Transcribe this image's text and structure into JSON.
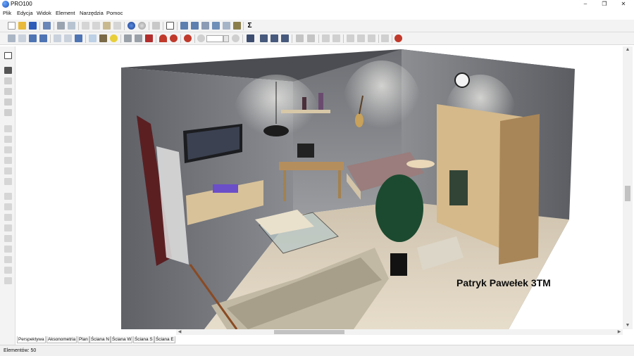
{
  "window": {
    "title": "PRO100",
    "minimize": "–",
    "restore": "❐",
    "close": "✕"
  },
  "menu": [
    "Plik",
    "Edycja",
    "Widok",
    "Element",
    "Narzędzia",
    "Pomoc"
  ],
  "toolbar_top": [
    "new",
    "open",
    "save",
    "save-as",
    "print",
    "print-preview",
    "cut",
    "copy",
    "paste",
    "delete",
    "render",
    "globe",
    "undo",
    "properties",
    "view-front",
    "view-back",
    "view-left",
    "view-right",
    "view-top",
    "sum"
  ],
  "toolbar_top_sum": "Σ",
  "toolbar_second_zoom_value": "",
  "left_tools": [
    "select",
    "move",
    "rotate",
    "pan",
    "measure",
    "zoom-area"
  ],
  "canvas": {
    "author_text": "Patryk Pawełek 3TM",
    "scene": "3D room perspective: living room with sofa, glass table, TV, desk, bed, wardrobe, potted plant"
  },
  "view_tabs": [
    "Perspektywa",
    "Aksonometria",
    "Plan",
    "Ściana N",
    "Ściana W",
    "Ściana S",
    "Ściana E"
  ],
  "view_tabs_active": "Perspektywa",
  "status": {
    "elements": "Elementów: 50"
  },
  "colors": {
    "toolbar_bg": "#f3f3f3",
    "wall_gray": "#777a80",
    "floor_wood": "#dcd2c1",
    "accent_blue": "#2a63c8"
  }
}
